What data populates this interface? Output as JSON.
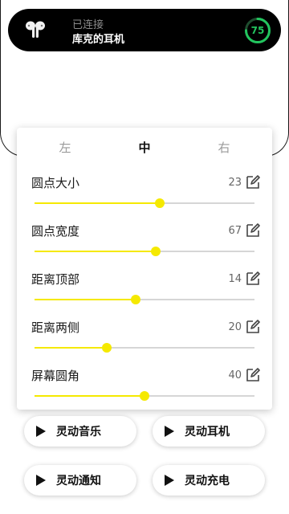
{
  "island": {
    "status": "已连接",
    "device_name": "库克的耳机",
    "battery": 75,
    "battery_color": "#22c55e",
    "icon": "earbuds-icon"
  },
  "tabs": [
    {
      "label": "左",
      "active": false
    },
    {
      "label": "中",
      "active": true
    },
    {
      "label": "右",
      "active": false
    }
  ],
  "settings": [
    {
      "label": "圆点大小",
      "value": "23",
      "level": 0.57
    },
    {
      "label": "圆点宽度",
      "value": "67",
      "level": 0.55
    },
    {
      "label": "距离顶部",
      "value": "14",
      "level": 0.46
    },
    {
      "label": "距离两侧",
      "value": "20",
      "level": 0.33
    },
    {
      "label": "屏幕圆角",
      "value": "40",
      "level": 0.5
    }
  ],
  "slider_color": "#f5e900",
  "buttons": [
    {
      "label": "灵动音乐",
      "icon": "play-icon"
    },
    {
      "label": "灵动耳机",
      "icon": "play-icon"
    },
    {
      "label": "灵动通知",
      "icon": "play-icon"
    },
    {
      "label": "灵动充电",
      "icon": "play-icon"
    }
  ]
}
